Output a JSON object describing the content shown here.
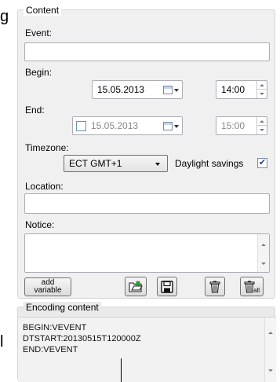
{
  "stray": {
    "top_char": "g",
    "bottom_char": "l"
  },
  "content": {
    "legend": "Content",
    "event_label": "Event:",
    "event_value": "",
    "begin_label": "Begin:",
    "begin_date": "15.05.2013",
    "begin_time": "14:00",
    "end_label": "End:",
    "end_checked": false,
    "end_date": "15.05.2013",
    "end_time": "15:00",
    "timezone_label": "Timezone:",
    "timezone_value": "ECT GMT+1",
    "daylight_label": "Daylight savings",
    "daylight_checked": true,
    "location_label": "Location:",
    "location_value": "",
    "notice_label": "Notice:",
    "notice_value": "",
    "add_variable_line1": "add",
    "add_variable_line2": "variable",
    "delete_all_sub": "all"
  },
  "encoding": {
    "legend": "Encoding content",
    "line1": "BEGIN:VEVENT",
    "line2": "DTSTART:20130515T120000Z",
    "line3": "END:VEVENT"
  }
}
